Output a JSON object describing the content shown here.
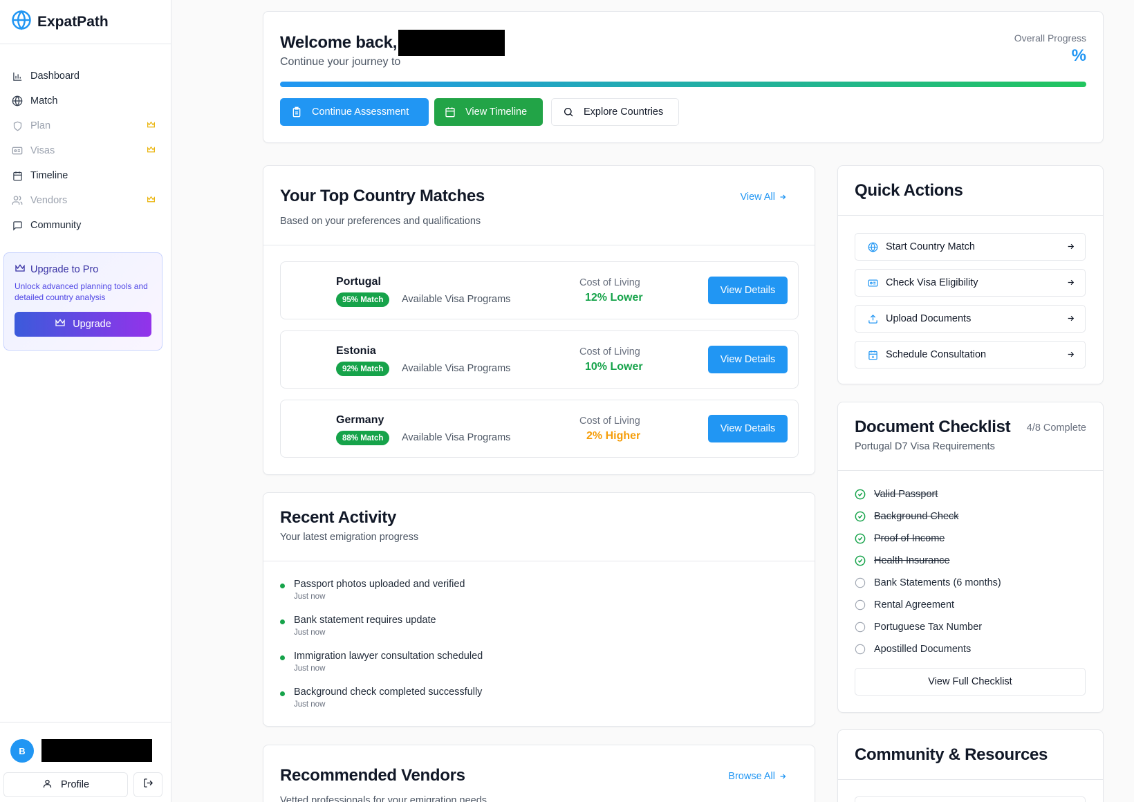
{
  "app": {
    "name": "ExpatPath"
  },
  "sidebar": {
    "items": [
      {
        "label": "Dashboard",
        "icon": "bar-chart-icon",
        "locked": false
      },
      {
        "label": "Match",
        "icon": "globe-icon",
        "locked": false
      },
      {
        "label": "Plan",
        "icon": "shield-icon",
        "locked": true
      },
      {
        "label": "Visas",
        "icon": "id-card-icon",
        "locked": true
      },
      {
        "label": "Timeline",
        "icon": "calendar-icon",
        "locked": false
      },
      {
        "label": "Vendors",
        "icon": "users-icon",
        "locked": true
      },
      {
        "label": "Community",
        "icon": "message-icon",
        "locked": false
      }
    ],
    "upgrade": {
      "title": "Upgrade to Pro",
      "description": "Unlock advanced planning tools and detailed country analysis",
      "button": "Upgrade"
    },
    "user": {
      "avatar_initial": "B",
      "profile_label": "Profile"
    }
  },
  "welcome": {
    "title": "Welcome back,",
    "subtitle": "Continue your journey to",
    "progress_label": "Overall Progress",
    "progress_value": "%",
    "progress_fill": 1.0,
    "buttons": {
      "continue": "Continue Assessment",
      "timeline": "View Timeline",
      "explore": "Explore Countries"
    }
  },
  "matches": {
    "title": "Your Top Country Matches",
    "subtitle": "Based on your preferences and qualifications",
    "view_all": "View All",
    "cost_label": "Cost of Living",
    "visa_label": "Available Visa Programs",
    "details_label": "View Details",
    "rows": [
      {
        "country": "Portugal",
        "match": "95% Match",
        "cost": "12% Lower",
        "cost_color": "#16a34a"
      },
      {
        "country": "Estonia",
        "match": "92% Match",
        "cost": "10% Lower",
        "cost_color": "#16a34a"
      },
      {
        "country": "Germany",
        "match": "88% Match",
        "cost": "2% Higher",
        "cost_color": "#f59e0b"
      }
    ]
  },
  "activity": {
    "title": "Recent Activity",
    "subtitle": "Your latest emigration progress",
    "items": [
      {
        "text": "Passport photos uploaded and verified",
        "time": "Just now"
      },
      {
        "text": "Bank statement requires update",
        "time": "Just now"
      },
      {
        "text": "Immigration lawyer consultation scheduled",
        "time": "Just now"
      },
      {
        "text": "Background check completed successfully",
        "time": "Just now"
      }
    ]
  },
  "vendors": {
    "title": "Recommended Vendors",
    "subtitle": "Vetted professionals for your emigration needs",
    "browse_all": "Browse All"
  },
  "quick_actions": {
    "title": "Quick Actions",
    "items": [
      {
        "label": "Start Country Match",
        "icon": "globe-icon"
      },
      {
        "label": "Check Visa Eligibility",
        "icon": "id-card-icon"
      },
      {
        "label": "Upload Documents",
        "icon": "upload-icon"
      },
      {
        "label": "Schedule Consultation",
        "icon": "calendar-plus-icon"
      }
    ]
  },
  "checklist": {
    "title": "Document Checklist",
    "status": "4/8 Complete",
    "subtitle": "Portugal D7 Visa Requirements",
    "items": [
      {
        "label": "Valid Passport",
        "done": true
      },
      {
        "label": "Background Check",
        "done": true
      },
      {
        "label": "Proof of Income",
        "done": true
      },
      {
        "label": "Health Insurance",
        "done": true
      },
      {
        "label": "Bank Statements (6 months)",
        "done": false
      },
      {
        "label": "Rental Agreement",
        "done": false
      },
      {
        "label": "Portuguese Tax Number",
        "done": false
      },
      {
        "label": "Apostilled Documents",
        "done": false
      }
    ],
    "button": "View Full Checklist"
  },
  "community": {
    "title": "Community & Resources"
  },
  "colors": {
    "primary": "#2196f3",
    "success": "#16a34a",
    "warning": "#f59e0b",
    "pro": "#4f46e5"
  }
}
